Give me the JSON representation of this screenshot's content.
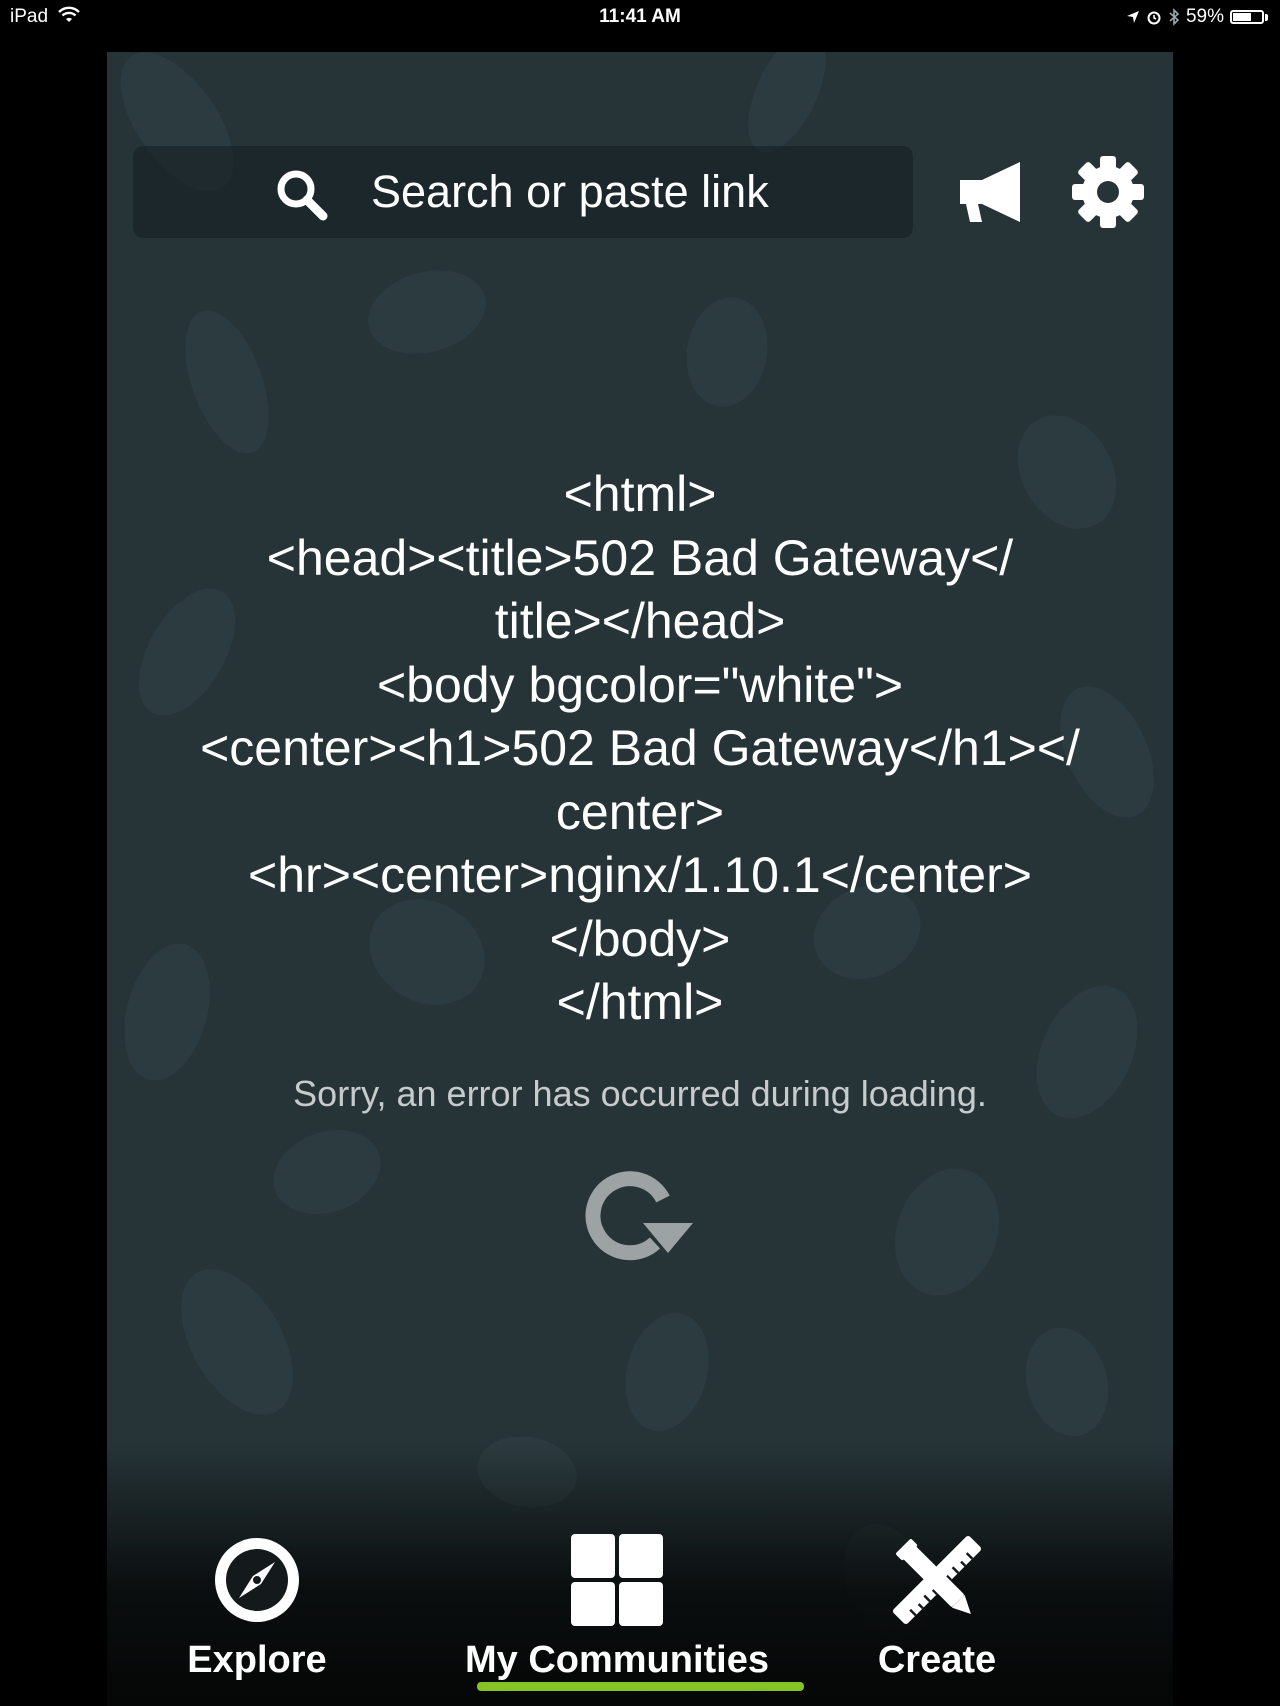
{
  "status_bar": {
    "device": "iPad",
    "time": "11:41 AM",
    "battery": "59%",
    "battery_level": 0.59
  },
  "header": {
    "search_placeholder": "Search or paste link",
    "icons": [
      "search-icon",
      "megaphone-icon",
      "gear-icon"
    ]
  },
  "error": {
    "lines": [
      "<html>",
      "<head><title>502 Bad Gateway</",
      "title></head>",
      "<body bgcolor=\"white\">",
      "<center><h1>502 Bad Gateway</h1></",
      "center>",
      "<hr><center>nginx/1.10.1</center>",
      "</body>",
      "</html>"
    ],
    "message": "Sorry, an error has occurred during loading.",
    "reload_icon": "reload-icon"
  },
  "tabs": {
    "explore": {
      "label": "Explore",
      "icon": "compass-icon"
    },
    "communities": {
      "label": "My Communities",
      "icon": "grid-icon",
      "selected": true
    },
    "create": {
      "label": "Create",
      "icon": "pencil-ruler-icon"
    }
  },
  "colors": {
    "background": "#263438",
    "accent": "#84c225",
    "text": "#ffffff",
    "muted_text": "#c7cbcc"
  }
}
